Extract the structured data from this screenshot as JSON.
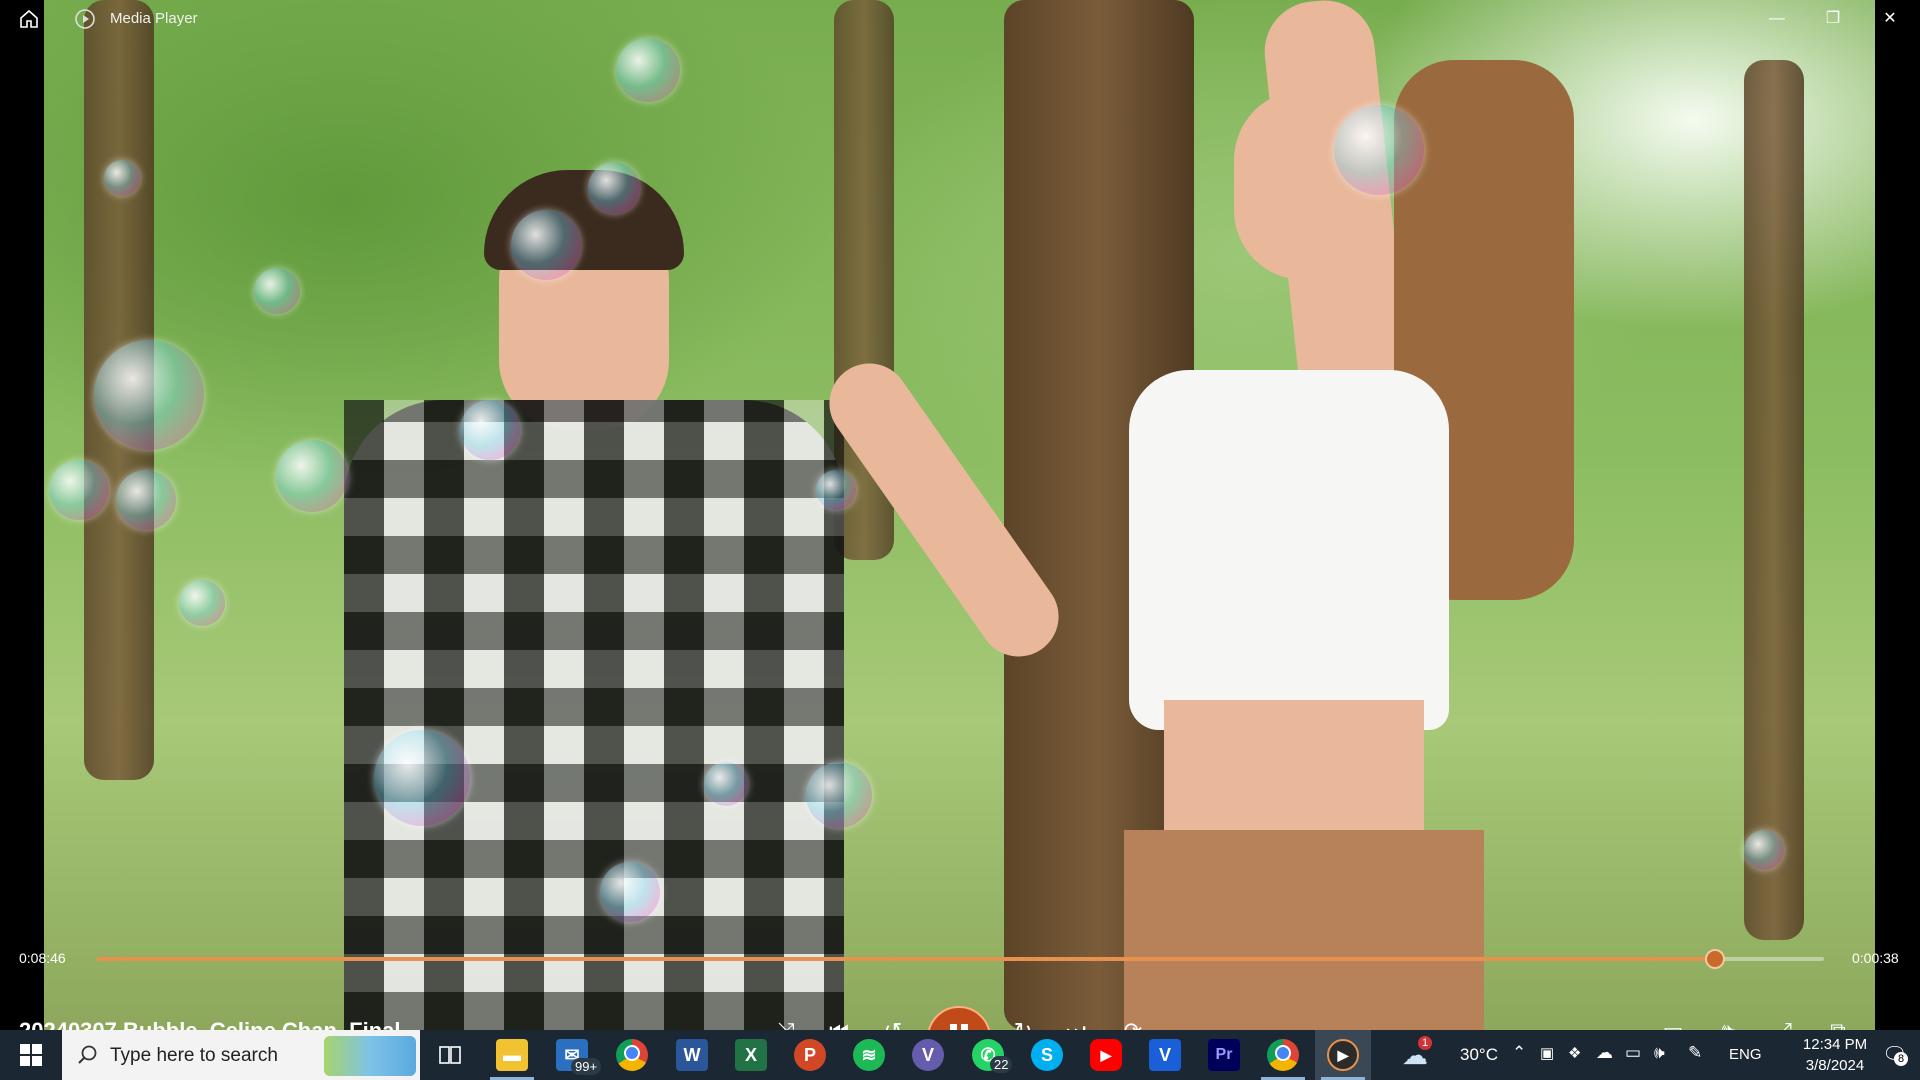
{
  "window": {
    "title": "Media Player",
    "buttons": [
      "minimize",
      "restore",
      "close"
    ]
  },
  "player": {
    "elapsed": "0:08:46",
    "remaining": "0:00:38",
    "progress_fraction": 0.937,
    "filename": "20240307 Bubble_Celine Chan_Final",
    "accent_color": "#e8914f"
  },
  "taskbar": {
    "search_placeholder": "Type here to search",
    "apps": [
      {
        "name": "task-view",
        "icon": "task-view-icon"
      },
      {
        "name": "file-explorer",
        "icon": "folder-icon"
      },
      {
        "name": "mail",
        "icon": "mail-icon",
        "badge": "99+"
      },
      {
        "name": "chrome",
        "icon": "chrome-icon"
      },
      {
        "name": "word",
        "icon": "word-icon",
        "glyph": "W"
      },
      {
        "name": "excel",
        "icon": "excel-icon",
        "glyph": "X"
      },
      {
        "name": "powerpoint",
        "icon": "powerpoint-icon",
        "glyph": "P"
      },
      {
        "name": "spotify",
        "icon": "spotify-icon"
      },
      {
        "name": "viber",
        "icon": "viber-icon",
        "glyph": "V"
      },
      {
        "name": "whatsapp",
        "icon": "whatsapp-icon",
        "badge": "22"
      },
      {
        "name": "skype",
        "icon": "skype-icon",
        "glyph": "S"
      },
      {
        "name": "youtube",
        "icon": "youtube-icon"
      },
      {
        "name": "vimeo",
        "icon": "v-icon",
        "glyph": "V"
      },
      {
        "name": "premiere-pro",
        "icon": "premiere-icon",
        "glyph": "Pr"
      },
      {
        "name": "chrome-2",
        "icon": "chrome-icon"
      },
      {
        "name": "media-player",
        "icon": "media-player-icon"
      }
    ],
    "weather": {
      "temp": "30°C",
      "alert_badge": "1"
    },
    "language": "ENG",
    "time": "12:34 PM",
    "date": "3/8/2024",
    "notifications": "8"
  }
}
